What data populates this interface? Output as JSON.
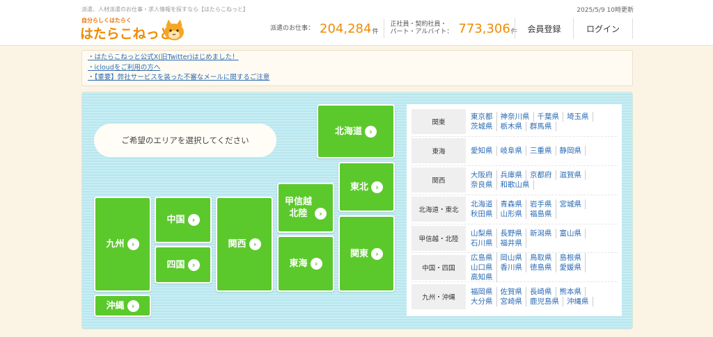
{
  "header": {
    "tagline": "派遣、人材派遣のお仕事・求人情報を探すなら【はたらこねっと】",
    "updated": "2025/5/9 10時更新",
    "logo_sub": "自分らしくはたらく",
    "logo_main": "はたらこねっと",
    "dispatch_label": "派遣のお仕事：",
    "dispatch_count": "204,284",
    "unit": "件",
    "regular_label_1": "正社員・契約社員・",
    "regular_label_2": "パート・アルバイト：",
    "regular_count": "773,306",
    "member_register": "会員登録",
    "login": "ログイン"
  },
  "notices": [
    "・はたらこねっと公式X(旧Twitter)はじめました！",
    "・icloudをご利用の方へ",
    "・【重要】弊社サービスを装った不審なメールに関するご注意"
  ],
  "map": {
    "prompt": "ご希望のエリアを選択してください",
    "arrow": "›",
    "regions": {
      "hokkaido": "北海道",
      "tohoku": "東北",
      "koshinetsu_1": "甲信越",
      "koshinetsu_2": "北陸",
      "kanto": "関東",
      "tokai": "東海",
      "kansai": "関西",
      "chugoku": "中国",
      "shikoku": "四国",
      "kyushu": "九州",
      "okinawa": "沖縄"
    }
  },
  "prefectures": [
    {
      "area": "関東",
      "prefs": [
        "東京都",
        "神奈川県",
        "千葉県",
        "埼玉県",
        "茨城県",
        "栃木県",
        "群馬県"
      ]
    },
    {
      "area": "東海",
      "prefs": [
        "愛知県",
        "岐阜県",
        "三重県",
        "静岡県"
      ]
    },
    {
      "area": "関西",
      "prefs": [
        "大阪府",
        "兵庫県",
        "京都府",
        "滋賀県",
        "奈良県",
        "和歌山県"
      ]
    },
    {
      "area": "北海道・東北",
      "prefs": [
        "北海道",
        "青森県",
        "岩手県",
        "宮城県",
        "秋田県",
        "山形県",
        "福島県"
      ]
    },
    {
      "area": "甲信越・北陸",
      "prefs": [
        "山梨県",
        "長野県",
        "新潟県",
        "富山県",
        "石川県",
        "福井県"
      ]
    },
    {
      "area": "中国・四国",
      "prefs": [
        "広島県",
        "岡山県",
        "鳥取県",
        "島根県",
        "山口県",
        "香川県",
        "徳島県",
        "愛媛県",
        "高知県"
      ]
    },
    {
      "area": "九州・沖縄",
      "prefs": [
        "福岡県",
        "佐賀県",
        "長崎県",
        "熊本県",
        "大分県",
        "宮崎県",
        "鹿児島県",
        "沖縄県"
      ]
    }
  ],
  "colors": {
    "accent": "#f08a00",
    "region_green": "#5bc92c",
    "link": "#2b6bb5"
  }
}
